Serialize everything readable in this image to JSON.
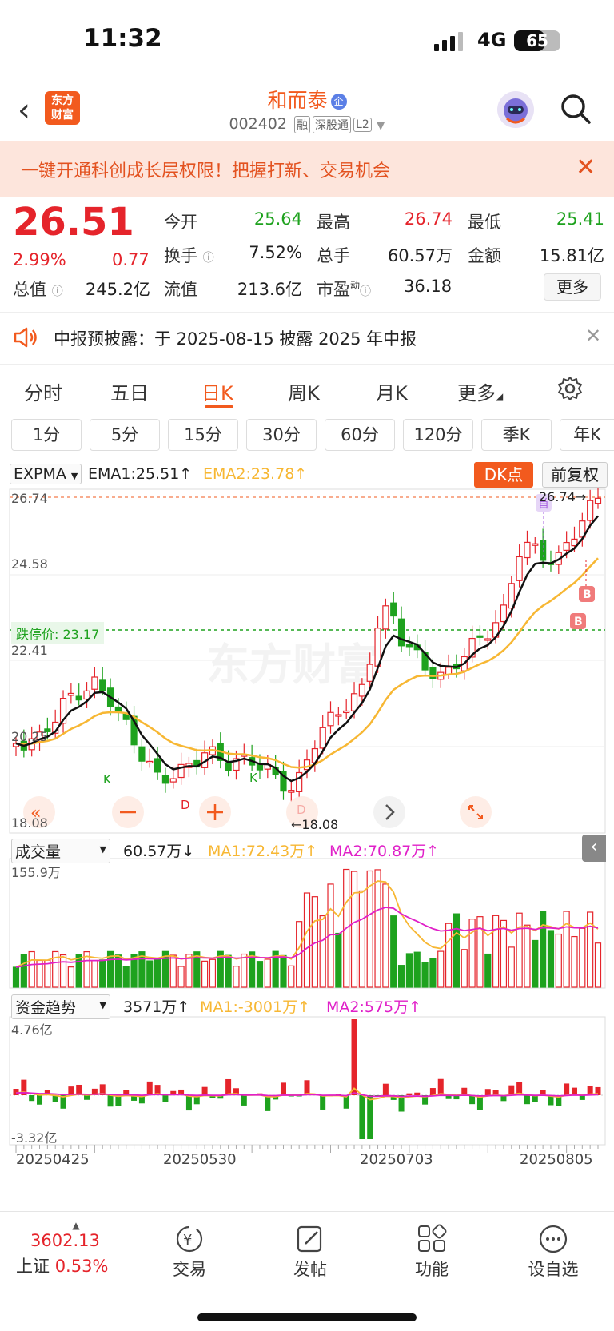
{
  "status_bar": {
    "time": "11:32",
    "network": "4G",
    "battery": "65",
    "battery_level": 0.65
  },
  "header": {
    "back_icon": "chevron-left-icon",
    "logo": "东方财富",
    "name": "和而泰",
    "name_badge": "企",
    "code": "002402",
    "tags": [
      "融",
      "深股通",
      "L2"
    ]
  },
  "promo": {
    "text": "一键开通科创成长层权限！把握打新、交易机会"
  },
  "quote": {
    "price": "26.51",
    "change_pct": "2.99%",
    "change": "0.77",
    "open_label": "今开",
    "open": "25.64",
    "high_label": "最高",
    "high": "26.74",
    "low_label": "最低",
    "low": "25.41",
    "turnover_label": "换手",
    "turnover": "7.52%",
    "volume_label": "总手",
    "volume": "60.57万",
    "amount_label": "金额",
    "amount": "15.81亿",
    "mktcap_label": "总值",
    "mktcap": "245.2亿",
    "float_label": "流值",
    "float": "213.6亿",
    "pe_label": "市盈",
    "pe_sup": "动",
    "pe": "36.18",
    "more": "更多"
  },
  "notice": {
    "text": "中报预披露：于 2025-08-15 披露 2025 年中报"
  },
  "tabs": [
    "分时",
    "五日",
    "日K",
    "周K",
    "月K",
    "更多"
  ],
  "active_tab": "日K",
  "periods": [
    "1分",
    "5分",
    "15分",
    "30分",
    "60分",
    "120分",
    "季K",
    "年K"
  ],
  "main_chart": {
    "indicator": "EXPMA",
    "ema1": "EMA1:25.51↑",
    "ema2": "EMA2:23.78↑",
    "dk_button": "DK点",
    "adjust_button": "前复权",
    "y_ticks": [
      "26.74",
      "24.58",
      "22.41",
      "20.25",
      "18.08"
    ],
    "limit_label": "跌停价: 23.17",
    "max_label": "26.74→",
    "min_label": "←18.08",
    "colors": {
      "up": "#e5242b",
      "down": "#1ea21e",
      "ema1": "#111111",
      "ema2": "#f7b733"
    }
  },
  "volume_chart": {
    "indicator": "成交量",
    "value": "60.57万↓",
    "ma1": "MA1:72.43万↑",
    "ma2": "MA2:70.87万↑",
    "max_label": "155.9万"
  },
  "fund_chart": {
    "indicator": "资金趋势",
    "value": "3571万↑",
    "ma1": "MA1:-3001万↑",
    "ma2": "MA2:575万↑",
    "max_label": "4.76亿",
    "min_label": "-3.32亿"
  },
  "dates": [
    "20250425",
    "20250530",
    "20250703",
    "20250805"
  ],
  "bottom_nav": {
    "index_value": "3602.13",
    "index_name": "上证",
    "index_change": "0.53%",
    "items": [
      "交易",
      "发帖",
      "功能",
      "设自选"
    ]
  }
}
